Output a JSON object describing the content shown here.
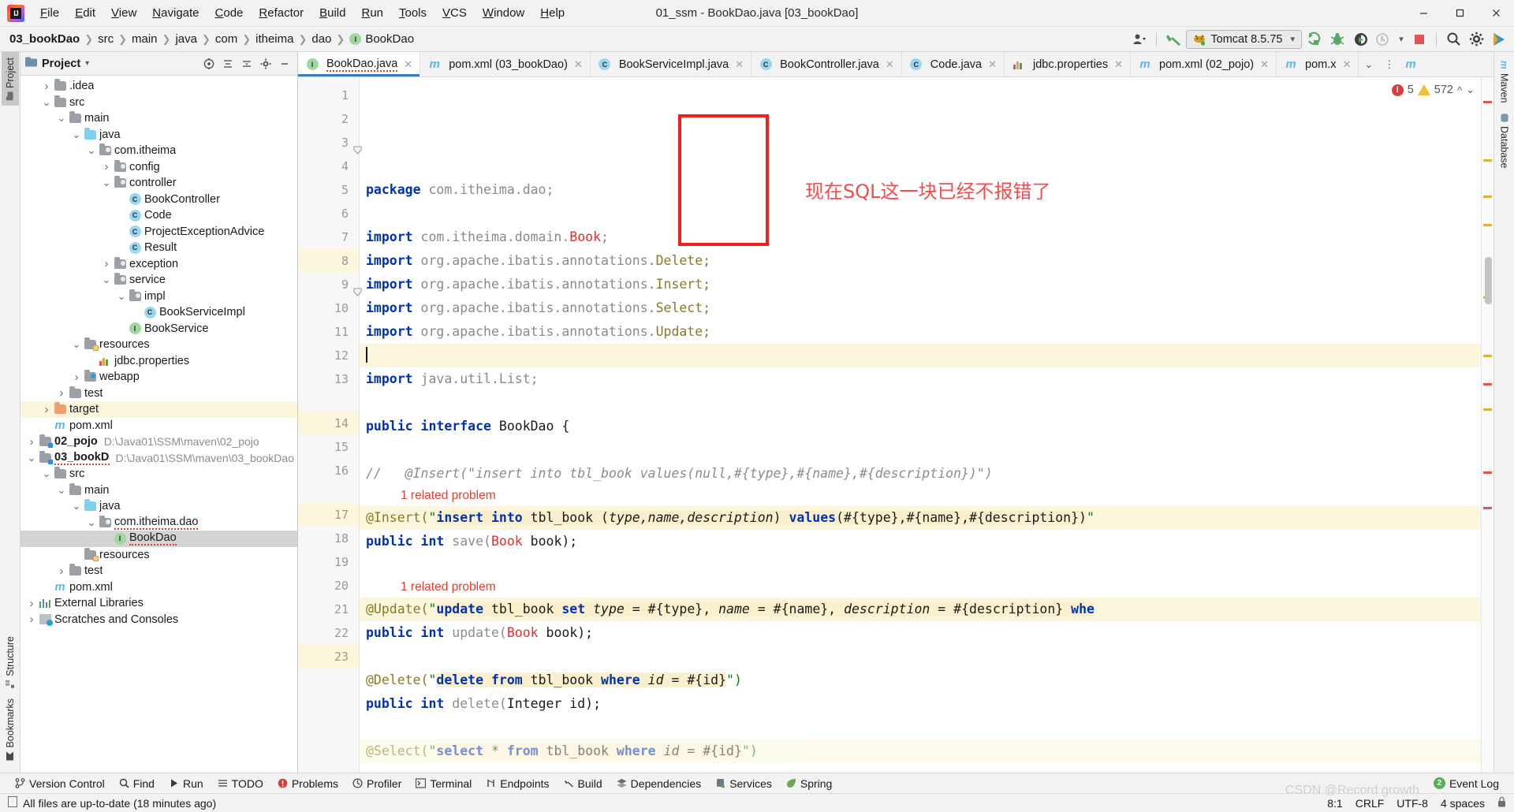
{
  "window": {
    "title": "01_ssm - BookDao.java [03_bookDao]",
    "logo": "intellij-idea-logo",
    "controls": [
      "minimize",
      "maximize",
      "close"
    ]
  },
  "menu": [
    "File",
    "Edit",
    "View",
    "Navigate",
    "Code",
    "Refactor",
    "Build",
    "Run",
    "Tools",
    "VCS",
    "Window",
    "Help"
  ],
  "breadcrumb": [
    {
      "label": "03_bookDao",
      "bold": true,
      "icon": ""
    },
    {
      "label": "src",
      "bold": false,
      "icon": ""
    },
    {
      "label": "main",
      "bold": false,
      "icon": ""
    },
    {
      "label": "java",
      "bold": false,
      "icon": ""
    },
    {
      "label": "com",
      "bold": false,
      "icon": ""
    },
    {
      "label": "itheima",
      "bold": false,
      "icon": ""
    },
    {
      "label": "dao",
      "bold": false,
      "icon": ""
    },
    {
      "label": "BookDao",
      "bold": false,
      "icon": "interface-badge"
    }
  ],
  "toolbar": {
    "run_config": "Tomcat 8.5.75",
    "run_config_icon": "tomcat-icon",
    "dropdown_icon": "chevron-down-icon",
    "buttons": [
      {
        "name": "user-settings-icon",
        "glyph": "user"
      },
      {
        "name": "build-hammer-icon",
        "glyph": "hammer"
      },
      {
        "name": "run-button",
        "glyph": "run"
      },
      {
        "name": "debug-button",
        "glyph": "debug"
      },
      {
        "name": "run-with-coverage-button",
        "glyph": "coverage"
      },
      {
        "name": "profile-button",
        "glyph": "profile"
      },
      {
        "name": "stop-button",
        "glyph": "stop"
      },
      {
        "name": "search-everywhere-icon",
        "glyph": "search"
      },
      {
        "name": "settings-gear-icon",
        "glyph": "gear"
      },
      {
        "name": "updates-icon",
        "glyph": "play-circle"
      }
    ]
  },
  "left_strip": [
    {
      "label": "Project",
      "active": true,
      "icon": "project-folder-icon"
    },
    {
      "label": "Structure",
      "active": false,
      "icon": "structure-icon"
    },
    {
      "label": "Bookmarks",
      "active": false,
      "icon": "bookmark-icon"
    }
  ],
  "right_strip": [
    {
      "label": "Maven",
      "active": false,
      "icon": "maven-icon"
    },
    {
      "label": "Database",
      "active": false,
      "icon": "database-icon"
    }
  ],
  "project_panel": {
    "title": "Project",
    "caret": "▾",
    "actions": [
      "target-icon",
      "collapse-all-icon",
      "expand-icon",
      "settings-icon",
      "hide-icon"
    ],
    "tree": [
      {
        "depth": 1,
        "arrow": "collapsed",
        "icon": "folder",
        "label": ".idea",
        "path": ""
      },
      {
        "depth": 1,
        "arrow": "expanded",
        "icon": "folder",
        "label": "src",
        "path": ""
      },
      {
        "depth": 2,
        "arrow": "expanded",
        "icon": "folder",
        "label": "main",
        "path": ""
      },
      {
        "depth": 3,
        "arrow": "expanded",
        "icon": "folder-blue",
        "label": "java",
        "path": ""
      },
      {
        "depth": 4,
        "arrow": "expanded",
        "icon": "package",
        "label": "com.itheima",
        "path": ""
      },
      {
        "depth": 5,
        "arrow": "collapsed",
        "icon": "package",
        "label": "config",
        "path": ""
      },
      {
        "depth": 5,
        "arrow": "expanded",
        "icon": "package",
        "label": "controller",
        "path": ""
      },
      {
        "depth": 6,
        "arrow": "none",
        "icon": "class",
        "label": "BookController",
        "path": ""
      },
      {
        "depth": 6,
        "arrow": "none",
        "icon": "class",
        "label": "Code",
        "path": ""
      },
      {
        "depth": 6,
        "arrow": "none",
        "icon": "class",
        "label": "ProjectExceptionAdvice",
        "path": ""
      },
      {
        "depth": 6,
        "arrow": "none",
        "icon": "class",
        "label": "Result",
        "path": ""
      },
      {
        "depth": 5,
        "arrow": "collapsed",
        "icon": "package",
        "label": "exception",
        "path": ""
      },
      {
        "depth": 5,
        "arrow": "expanded",
        "icon": "package",
        "label": "service",
        "path": ""
      },
      {
        "depth": 6,
        "arrow": "expanded",
        "icon": "package",
        "label": "impl",
        "path": ""
      },
      {
        "depth": 7,
        "arrow": "none",
        "icon": "class",
        "label": "BookServiceImpl",
        "path": ""
      },
      {
        "depth": 6,
        "arrow": "none",
        "icon": "interface",
        "label": "BookService",
        "path": ""
      },
      {
        "depth": 3,
        "arrow": "expanded",
        "icon": "folder-res",
        "label": "resources",
        "path": ""
      },
      {
        "depth": 4,
        "arrow": "none",
        "icon": "properties",
        "label": "jdbc.properties",
        "path": ""
      },
      {
        "depth": 3,
        "arrow": "collapsed",
        "icon": "folder-web",
        "label": "webapp",
        "path": ""
      },
      {
        "depth": 2,
        "arrow": "collapsed",
        "icon": "folder",
        "label": "test",
        "path": ""
      },
      {
        "depth": 1,
        "arrow": "collapsed",
        "icon": "folder-orange",
        "label": "target",
        "path": "",
        "highlight": true
      },
      {
        "depth": 1,
        "arrow": "none",
        "icon": "maven",
        "label": "pom.xml",
        "path": ""
      },
      {
        "depth": 0,
        "arrow": "collapsed",
        "icon": "module",
        "label": "02_pojo",
        "bold": true,
        "path": "D:\\Java01\\SSM\\maven\\02_pojo"
      },
      {
        "depth": 0,
        "arrow": "expanded",
        "icon": "module",
        "label": "03_bookDao",
        "bold": true,
        "path": "D:\\Java01\\SSM\\maven\\03_bookDao",
        "squiggle": true
      },
      {
        "depth": 1,
        "arrow": "expanded",
        "icon": "folder",
        "label": "src",
        "path": ""
      },
      {
        "depth": 2,
        "arrow": "expanded",
        "icon": "folder",
        "label": "main",
        "path": ""
      },
      {
        "depth": 3,
        "arrow": "expanded",
        "icon": "folder-blue",
        "label": "java",
        "path": ""
      },
      {
        "depth": 4,
        "arrow": "expanded",
        "icon": "package",
        "label": "com.itheima.dao",
        "path": "",
        "squiggle": true
      },
      {
        "depth": 5,
        "arrow": "none",
        "icon": "interface",
        "label": "BookDao",
        "path": "",
        "selected": true,
        "squiggle": true
      },
      {
        "depth": 3,
        "arrow": "none",
        "icon": "folder-res",
        "label": "resources",
        "path": ""
      },
      {
        "depth": 2,
        "arrow": "collapsed",
        "icon": "folder",
        "label": "test",
        "path": ""
      },
      {
        "depth": 1,
        "arrow": "none",
        "icon": "maven",
        "label": "pom.xml",
        "path": ""
      },
      {
        "depth": 0,
        "arrow": "collapsed",
        "icon": "libraries",
        "label": "External Libraries",
        "path": ""
      },
      {
        "depth": 0,
        "arrow": "collapsed",
        "icon": "scratches",
        "label": "Scratches and Consoles",
        "path": ""
      }
    ]
  },
  "editor_tabs": [
    {
      "label": "BookDao.java",
      "icon": "interface",
      "active": true,
      "error": true
    },
    {
      "label": "pom.xml (03_bookDao)",
      "icon": "maven",
      "active": false,
      "error": false
    },
    {
      "label": "BookServiceImpl.java",
      "icon": "class",
      "active": false,
      "error": false
    },
    {
      "label": "BookController.java",
      "icon": "class",
      "active": false,
      "error": false
    },
    {
      "label": "Code.java",
      "icon": "class",
      "active": false,
      "error": false
    },
    {
      "label": "jdbc.properties",
      "icon": "properties",
      "active": false,
      "error": false
    },
    {
      "label": "pom.xml (02_pojo)",
      "icon": "maven",
      "active": false,
      "error": false
    },
    {
      "label": "pom.x",
      "icon": "maven",
      "active": false,
      "error": false
    }
  ],
  "editor_tabs_overflow": [
    "chevron-down-icon",
    "more-vertical-icon"
  ],
  "inspections": {
    "errors": "5",
    "warnings": "572",
    "up": "⌃",
    "down": "⌄"
  },
  "annotation": {
    "text": "现在SQL这一块已经不报错了",
    "color": "#f64b4b",
    "box_color": "#f02020"
  },
  "code_lines": [
    {
      "n": "1",
      "type": "code",
      "highlight": false,
      "fold": false,
      "spans": [
        {
          "t": "package ",
          "c": "kw"
        },
        {
          "t": "com.itheima.dao;",
          "c": "pkg"
        }
      ]
    },
    {
      "n": "2",
      "type": "code",
      "highlight": false,
      "fold": false,
      "spans": []
    },
    {
      "n": "3",
      "type": "code",
      "highlight": false,
      "fold": true,
      "spans": [
        {
          "t": "import ",
          "c": "kw"
        },
        {
          "t": "com.itheima.domain.",
          "c": "pkg"
        },
        {
          "t": "Book",
          "c": "cls"
        },
        {
          "t": ";",
          "c": "pkg"
        }
      ]
    },
    {
      "n": "4",
      "type": "code",
      "highlight": false,
      "fold": false,
      "spans": [
        {
          "t": "import ",
          "c": "kw"
        },
        {
          "t": "org.apache.ibatis.annotations",
          "c": "pkg"
        },
        {
          "t": ".Delete;",
          "c": "ann"
        }
      ]
    },
    {
      "n": "5",
      "type": "code",
      "highlight": false,
      "fold": false,
      "spans": [
        {
          "t": "import ",
          "c": "kw"
        },
        {
          "t": "org.apache.ibatis.annotations",
          "c": "pkg"
        },
        {
          "t": ".Insert;",
          "c": "ann"
        }
      ]
    },
    {
      "n": "6",
      "type": "code",
      "highlight": false,
      "fold": false,
      "spans": [
        {
          "t": "import ",
          "c": "kw"
        },
        {
          "t": "org.apache.ibatis.annotations",
          "c": "pkg"
        },
        {
          "t": ".Select;",
          "c": "ann"
        }
      ]
    },
    {
      "n": "7",
      "type": "code",
      "highlight": false,
      "fold": false,
      "spans": [
        {
          "t": "import ",
          "c": "kw"
        },
        {
          "t": "org.apache.ibatis.annotations",
          "c": "pkg"
        },
        {
          "t": ".Update;",
          "c": "ann"
        }
      ]
    },
    {
      "n": "8",
      "type": "code",
      "highlight": true,
      "caret": true,
      "fold": false,
      "spans": []
    },
    {
      "n": "9",
      "type": "code",
      "highlight": false,
      "fold": true,
      "spans": [
        {
          "t": "import ",
          "c": "kw"
        },
        {
          "t": "java.util.List;",
          "c": "pkg"
        }
      ]
    },
    {
      "n": "10",
      "type": "code",
      "highlight": false,
      "fold": false,
      "spans": []
    },
    {
      "n": "11",
      "type": "code",
      "highlight": false,
      "fold": false,
      "spans": [
        {
          "t": "public interface ",
          "c": "kw"
        },
        {
          "t": "BookDao {",
          "c": "plain"
        }
      ]
    },
    {
      "n": "12",
      "type": "code",
      "highlight": false,
      "fold": false,
      "spans": []
    },
    {
      "n": "13",
      "type": "code",
      "highlight": false,
      "fold": false,
      "spans": [
        {
          "t": "//   @Insert(\"insert into tbl_book values(null,#{type},#{name},#{description})\")",
          "c": "cmt"
        }
      ]
    },
    {
      "n": "",
      "type": "hint",
      "text": "1 related problem"
    },
    {
      "n": "14",
      "type": "code",
      "highlight": true,
      "fold": false,
      "spans": [
        {
          "t": "@Insert(",
          "c": "ann"
        },
        {
          "t": "\"",
          "c": "str"
        },
        {
          "t": "insert into ",
          "c": "sqlkw sqlbg"
        },
        {
          "t": "tbl_book ",
          "c": "sqlp sqlbg"
        },
        {
          "t": "(",
          "c": "sqlp sqlbg"
        },
        {
          "t": "type,name,description",
          "c": "sqlid sqlbg"
        },
        {
          "t": ") ",
          "c": "sqlp sqlbg"
        },
        {
          "t": "values",
          "c": "sqlkw sqlbg"
        },
        {
          "t": "(#{type},#{name},#{description})",
          "c": "sqlp sqlbg"
        },
        {
          "t": "\"",
          "c": "str"
        }
      ]
    },
    {
      "n": "15",
      "type": "code",
      "highlight": false,
      "fold": false,
      "spans": [
        {
          "t": "public int ",
          "c": "kw"
        },
        {
          "t": "save(",
          "c": "gray"
        },
        {
          "t": "Book",
          "c": "cls"
        },
        {
          "t": " book);",
          "c": "plain"
        }
      ]
    },
    {
      "n": "16",
      "type": "code",
      "highlight": false,
      "fold": false,
      "spans": []
    },
    {
      "n": "",
      "type": "hint",
      "text": "1 related problem"
    },
    {
      "n": "17",
      "type": "code",
      "highlight": true,
      "fold": false,
      "spans": [
        {
          "t": "@Update(",
          "c": "ann"
        },
        {
          "t": "\"",
          "c": "str"
        },
        {
          "t": "update ",
          "c": "sqlkw sqlbg"
        },
        {
          "t": "tbl_book ",
          "c": "sqlp sqlbg"
        },
        {
          "t": "set ",
          "c": "sqlkw sqlbg"
        },
        {
          "t": "type",
          "c": "sqlid sqlbg"
        },
        {
          "t": " = #{type}, ",
          "c": "sqlp sqlbg"
        },
        {
          "t": "name",
          "c": "sqlid sqlbg"
        },
        {
          "t": " = #{name}, ",
          "c": "sqlp sqlbg"
        },
        {
          "t": "description",
          "c": "sqlid sqlbg"
        },
        {
          "t": " = #{description} ",
          "c": "sqlp sqlbg"
        },
        {
          "t": "whe",
          "c": "sqlkw sqlbg"
        }
      ]
    },
    {
      "n": "18",
      "type": "code",
      "highlight": false,
      "fold": false,
      "spans": [
        {
          "t": "public int ",
          "c": "kw"
        },
        {
          "t": "update(",
          "c": "gray"
        },
        {
          "t": "Book",
          "c": "cls"
        },
        {
          "t": " book);",
          "c": "plain"
        }
      ]
    },
    {
      "n": "19",
      "type": "code",
      "highlight": false,
      "fold": false,
      "spans": []
    },
    {
      "n": "20",
      "type": "code",
      "highlight": false,
      "fold": false,
      "spans": [
        {
          "t": "@Delete(",
          "c": "ann"
        },
        {
          "t": "\"",
          "c": "str"
        },
        {
          "t": "delete from ",
          "c": "sqlkw sqlbg"
        },
        {
          "t": "tbl_book ",
          "c": "sqlp sqlbg"
        },
        {
          "t": "where ",
          "c": "sqlkw sqlbg"
        },
        {
          "t": "id",
          "c": "sqlid sqlbg"
        },
        {
          "t": " = #{id}",
          "c": "sqlp sqlbg"
        },
        {
          "t": "\")",
          "c": "str"
        }
      ]
    },
    {
      "n": "21",
      "type": "code",
      "highlight": false,
      "fold": false,
      "spans": [
        {
          "t": "public int ",
          "c": "kw"
        },
        {
          "t": "delete(",
          "c": "gray"
        },
        {
          "t": "Integer",
          "c": "plain"
        },
        {
          "t": " id);",
          "c": "plain"
        }
      ]
    },
    {
      "n": "22",
      "type": "code",
      "highlight": false,
      "fold": false,
      "spans": []
    },
    {
      "n": "23",
      "type": "code",
      "highlight": true,
      "clipped": true,
      "fold": false,
      "spans": [
        {
          "t": "@Select(",
          "c": "ann"
        },
        {
          "t": "\"",
          "c": "str"
        },
        {
          "t": "select ",
          "c": "sqlkw sqlbg"
        },
        {
          "t": "* ",
          "c": "sqlp sqlbg"
        },
        {
          "t": "from ",
          "c": "sqlkw sqlbg"
        },
        {
          "t": "tbl_book ",
          "c": "sqlp sqlbg"
        },
        {
          "t": "where ",
          "c": "sqlkw sqlbg"
        },
        {
          "t": "id",
          "c": "sqlid sqlbg"
        },
        {
          "t": " = #{id}",
          "c": "sqlp sqlbg"
        },
        {
          "t": "\")",
          "c": "str"
        }
      ]
    }
  ],
  "bottom_tools": [
    {
      "label": "Version Control",
      "icon": "branch-icon"
    },
    {
      "label": "Find",
      "icon": "search-icon"
    },
    {
      "label": "Run",
      "icon": "play-icon"
    },
    {
      "label": "TODO",
      "icon": "list-icon"
    },
    {
      "label": "Problems",
      "icon": "error-icon"
    },
    {
      "label": "Profiler",
      "icon": "profiler-icon"
    },
    {
      "label": "Terminal",
      "icon": "terminal-icon"
    },
    {
      "label": "Endpoints",
      "icon": "endpoints-icon"
    },
    {
      "label": "Build",
      "icon": "hammer-icon"
    },
    {
      "label": "Dependencies",
      "icon": "layers-icon"
    },
    {
      "label": "Services",
      "icon": "services-icon"
    },
    {
      "label": "Spring",
      "icon": "spring-leaf-icon"
    }
  ],
  "event_log": {
    "label": "Event Log",
    "count": "2"
  },
  "status": {
    "message": "All files are up-to-date (18 minutes ago)",
    "message_icon": "document-icon",
    "caret_position": "8:1",
    "line_separator": "CRLF",
    "encoding": "UTF-8",
    "indent": "4 spaces",
    "lock_icon": "lock-icon"
  },
  "watermark": "CSDN @Record growth"
}
